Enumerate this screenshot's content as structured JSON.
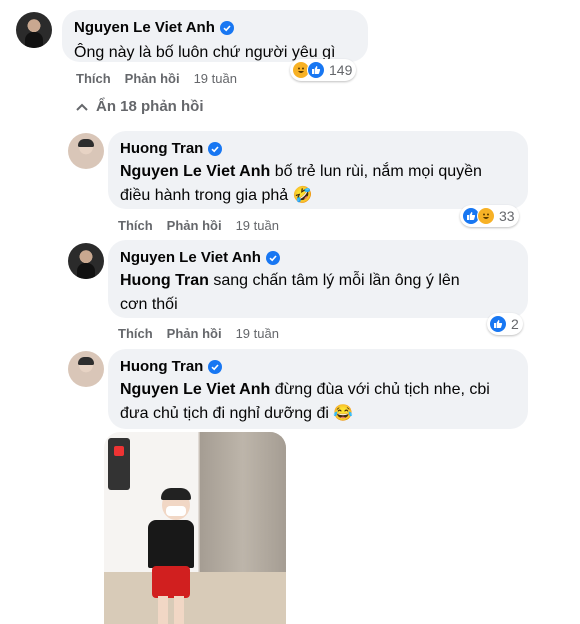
{
  "thread": {
    "top_comment": {
      "author": "Nguyen Le Viet Anh",
      "text": "Ông này là bố luôn chứ người yêu gì",
      "like_label": "Thích",
      "reply_label": "Phản hồi",
      "time": "19 tuần",
      "reaction_count": "149",
      "reaction_icons": [
        "haha-icon",
        "like-icon"
      ]
    },
    "hide_replies_label": "Ẩn 18 phản hồi",
    "replies": [
      {
        "author": "Huong Tran",
        "mention": "Nguyen Le Viet Anh",
        "text_line1": " bố trẻ lun rùi, nắm mọi quyền",
        "text_line2": "điều hành trong gia phả 🤣",
        "like_label": "Thích",
        "reply_label": "Phản hồi",
        "time": "19 tuần",
        "reaction_count": "33",
        "reaction_icons": [
          "like-icon",
          "haha-icon"
        ]
      },
      {
        "author": "Nguyen Le Viet Anh",
        "mention": "Huong Tran",
        "text_line1": " sang chấn tâm lý mỗi lần ông ý lên",
        "text_line2": "cơn thối",
        "like_label": "Thích",
        "reply_label": "Phản hồi",
        "time": "19 tuần",
        "reaction_count": "2",
        "reaction_icons": [
          "like-icon"
        ]
      },
      {
        "author": "Huong Tran",
        "mention": "Nguyen Le Viet Anh",
        "text_line1": " đừng đùa với chủ tịch nhe, cbi",
        "text_line2": "đưa chủ tịch đi nghỉ dưỡng đi 😂",
        "has_photo": true
      }
    ]
  },
  "colors": {
    "bubble": "#f0f2f5",
    "verified": "#1877f2",
    "secondary_text": "#65676b",
    "like": "#1877f2",
    "haha": "#f7b125"
  }
}
